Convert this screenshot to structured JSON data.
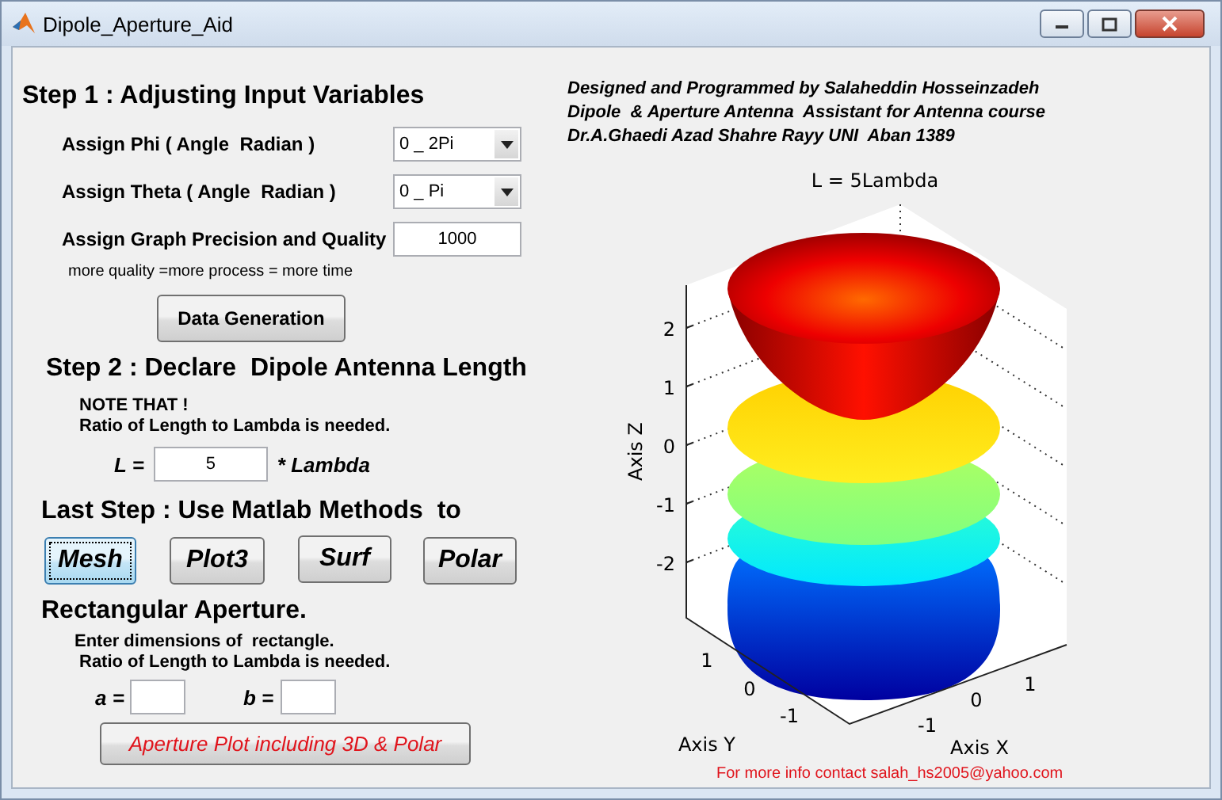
{
  "window": {
    "title": "Dipole_Aperture_Aid"
  },
  "step1": {
    "heading": "Step 1 : Adjusting Input Variables",
    "phi": {
      "label": "Assign Phi ( Angle  Radian )",
      "value": "0 _ 2Pi"
    },
    "theta": {
      "label": "Assign Theta ( Angle  Radian )",
      "value": "0 _ Pi"
    },
    "precision": {
      "label": "Assign Graph Precision and Quality",
      "value": "1000",
      "note": "more quality =more process = more time"
    },
    "button": "Data Generation"
  },
  "step2": {
    "heading": "Step 2 : Declare  Dipole Antenna Length",
    "note_title": "NOTE THAT !",
    "note": "Ratio of Length to Lambda is needed.",
    "length_label": "L =",
    "length_value": "5",
    "length_unit": "* Lambda"
  },
  "last_step": {
    "heading": "Last Step : Use Matlab Methods  to",
    "buttons": [
      {
        "label": "Mesh",
        "selected": true
      },
      {
        "label": "Plot3",
        "selected": false
      },
      {
        "label": "Surf",
        "selected": false
      },
      {
        "label": "Polar",
        "selected": false
      }
    ]
  },
  "aperture": {
    "heading": "Rectangular Aperture.",
    "note_1": "Enter dimensions of  rectangle.",
    "note_2": "Ratio of Length to Lambda is needed.",
    "a_label": "a =",
    "b_label": "b =",
    "button": "Aperture Plot including 3D & Polar"
  },
  "credits": [
    "Designed and Programmed by Salaheddin Hosseinzadeh",
    "Dipole  & Aperture Antenna  Assistant for Antenna course",
    "Dr.A.Ghaedi Azad Shahre Rayy UNI  Aban 1389"
  ],
  "plot": {
    "title": "L =  5Lambda",
    "zlabel": "Axis Z",
    "ylabel": "Axis Y",
    "xlabel": "Axis X",
    "zticks": [
      "2",
      "1",
      "0",
      "-1",
      "-2"
    ],
    "yticks": [
      "1",
      "0",
      "-1"
    ],
    "xticks": [
      "1",
      "0",
      "-1"
    ]
  },
  "footer": "For more info contact salah_hs2005@yahoo.com"
}
